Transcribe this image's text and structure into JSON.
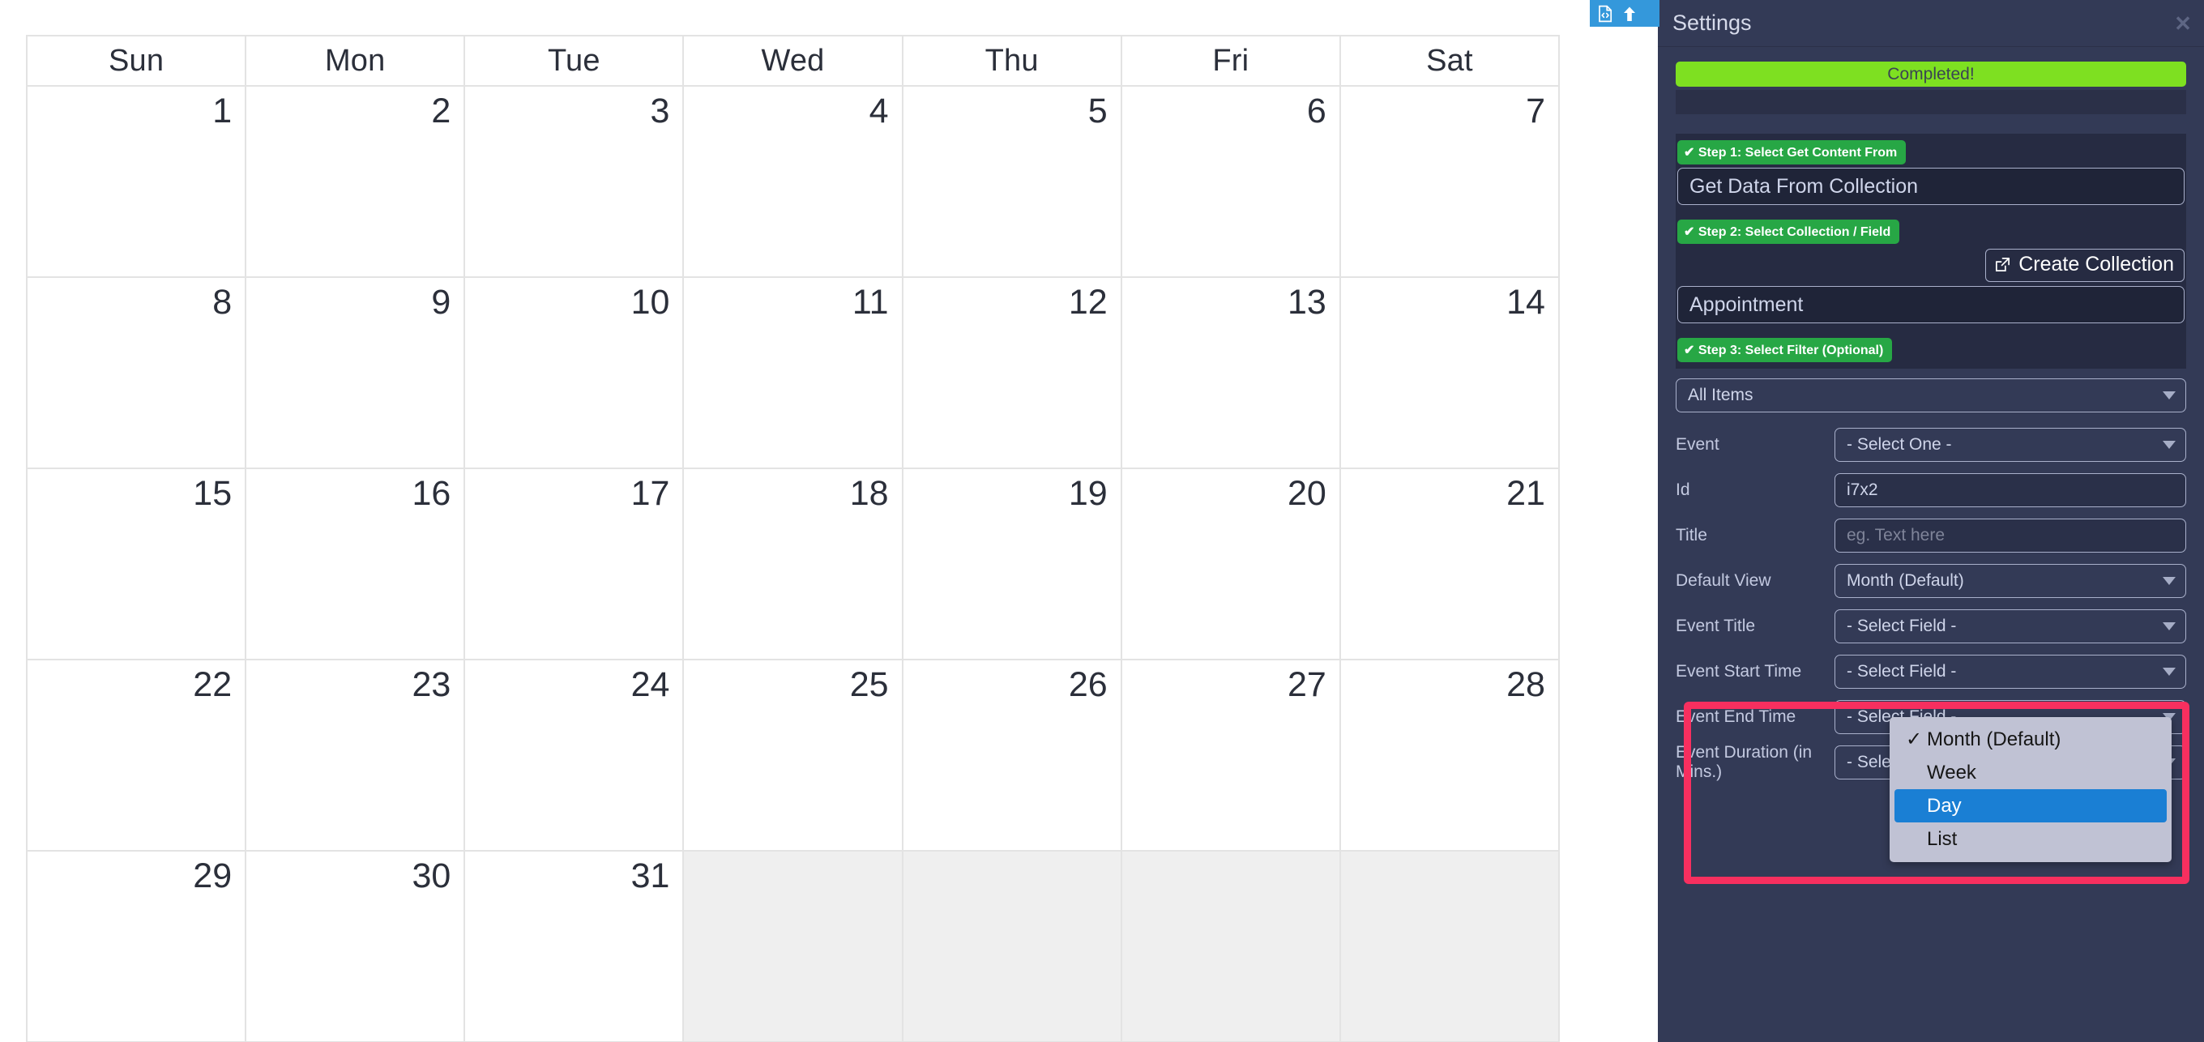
{
  "calendar": {
    "weekdays": [
      "Sun",
      "Mon",
      "Tue",
      "Wed",
      "Thu",
      "Fri",
      "Sat"
    ],
    "weeks": [
      [
        {
          "day": "1",
          "disabled": false
        },
        {
          "day": "2",
          "disabled": false
        },
        {
          "day": "3",
          "disabled": false
        },
        {
          "day": "4",
          "disabled": false
        },
        {
          "day": "5",
          "disabled": false
        },
        {
          "day": "6",
          "disabled": false
        },
        {
          "day": "7",
          "disabled": false
        }
      ],
      [
        {
          "day": "8",
          "disabled": false
        },
        {
          "day": "9",
          "disabled": false
        },
        {
          "day": "10",
          "disabled": false
        },
        {
          "day": "11",
          "disabled": false
        },
        {
          "day": "12",
          "disabled": false
        },
        {
          "day": "13",
          "disabled": false
        },
        {
          "day": "14",
          "disabled": false
        }
      ],
      [
        {
          "day": "15",
          "disabled": false
        },
        {
          "day": "16",
          "disabled": false
        },
        {
          "day": "17",
          "disabled": false
        },
        {
          "day": "18",
          "disabled": false
        },
        {
          "day": "19",
          "disabled": false
        },
        {
          "day": "20",
          "disabled": false
        },
        {
          "day": "21",
          "disabled": false
        }
      ],
      [
        {
          "day": "22",
          "disabled": false
        },
        {
          "day": "23",
          "disabled": false
        },
        {
          "day": "24",
          "disabled": false
        },
        {
          "day": "25",
          "disabled": false
        },
        {
          "day": "26",
          "disabled": false
        },
        {
          "day": "27",
          "disabled": false
        },
        {
          "day": "28",
          "disabled": false
        }
      ],
      [
        {
          "day": "29",
          "disabled": false
        },
        {
          "day": "30",
          "disabled": false
        },
        {
          "day": "31",
          "disabled": false
        },
        {
          "day": "",
          "disabled": true
        },
        {
          "day": "",
          "disabled": true
        },
        {
          "day": "",
          "disabled": true
        },
        {
          "day": "",
          "disabled": true
        }
      ]
    ]
  },
  "toolbar": {
    "code_icon": "code-file-icon",
    "upload_icon": "arrow-up-icon",
    "accent": "#3498db"
  },
  "settings": {
    "title": "Settings",
    "close_label": "✕",
    "status_banner": "Completed!",
    "step1": {
      "badge": "✔ Step 1: Select Get Content From",
      "value": "Get Data From Collection"
    },
    "step2": {
      "badge": "✔ Step 2: Select Collection / Field",
      "create_button": "Create Collection",
      "value": "Appointment"
    },
    "step3": {
      "badge": "✔ Step 3: Select Filter (Optional)",
      "filter_value": "All Items"
    },
    "fields": [
      {
        "label": "Event",
        "value": "- Select One -",
        "type": "select",
        "placeholder": false
      },
      {
        "label": "Id",
        "value": "i7x2",
        "type": "input",
        "placeholder": false
      },
      {
        "label": "Title",
        "value": "eg. Text here",
        "type": "input",
        "placeholder": true
      },
      {
        "label": "Default View",
        "value": "Month (Default)",
        "type": "select",
        "placeholder": false
      },
      {
        "label": "Event Title",
        "value": "- Select Field -",
        "type": "select",
        "placeholder": false
      },
      {
        "label": "Event Start Time",
        "value": "- Select Field -",
        "type": "select",
        "placeholder": false
      },
      {
        "label": "Event End Time",
        "value": "- Select Field -",
        "type": "select",
        "placeholder": false
      },
      {
        "label": "Event Duration (in Mins.)",
        "value": "- Select Duration -",
        "type": "select",
        "placeholder": false
      }
    ],
    "colors": {
      "panel_bg": "#333a56",
      "banner_green": "#7ee021",
      "badge_green": "#27a745",
      "highlight_pink": "#f72f5f",
      "dropdown_selected": "#1a7fd4"
    }
  },
  "dropdown": {
    "name": "default-view-dropdown",
    "options": [
      {
        "label": "Month (Default)",
        "checked": true,
        "selected": false
      },
      {
        "label": "Week",
        "checked": false,
        "selected": false
      },
      {
        "label": "Day",
        "checked": false,
        "selected": true
      },
      {
        "label": "List",
        "checked": false,
        "selected": false
      }
    ],
    "check_glyph": "✓"
  }
}
